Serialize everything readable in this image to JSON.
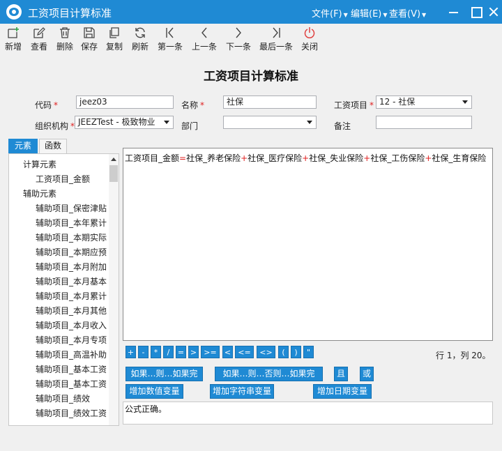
{
  "window": {
    "title": "工资项目计算标准",
    "menus": [
      {
        "label": "文件(F)"
      },
      {
        "label": "编辑(E)"
      },
      {
        "label": "查看(V)"
      }
    ],
    "accent": "#1f8ad4"
  },
  "toolbar": {
    "items": [
      {
        "label": "新增",
        "icon": "add-icon"
      },
      {
        "label": "查看",
        "icon": "edit-icon"
      },
      {
        "label": "删除",
        "icon": "trash-icon"
      },
      {
        "label": "保存",
        "icon": "save-icon"
      },
      {
        "label": "复制",
        "icon": "copy-icon"
      },
      {
        "label": "刷新",
        "icon": "refresh-icon"
      },
      {
        "label": "第一条",
        "icon": "first-icon"
      },
      {
        "label": "上一条",
        "icon": "prev-icon"
      },
      {
        "label": "下一条",
        "icon": "next-icon"
      },
      {
        "label": "最后一条",
        "icon": "last-icon"
      },
      {
        "label": "关闭",
        "icon": "power-icon"
      }
    ]
  },
  "form": {
    "heading": "工资项目计算标准",
    "code_label": "代码",
    "code_value": "jeez03",
    "name_label": "名称",
    "name_value": "社保",
    "item_label": "工资项目",
    "item_value": "12 - 社保",
    "org_label": "组织机构",
    "org_value": "JEEZTest  - 极致物业",
    "dept_label": "部门",
    "dept_value": "",
    "note_label": "备注",
    "note_value": "",
    "required_mark": "*"
  },
  "panel": {
    "tabs": [
      {
        "label": "元素"
      },
      {
        "label": "函数"
      }
    ],
    "tree": [
      {
        "label": "计算元素"
      },
      {
        "label": "工资项目_金额"
      },
      {
        "label": "辅助元素"
      },
      {
        "label": "辅助项目_保密津贴"
      },
      {
        "label": "辅助项目_本年累计"
      },
      {
        "label": "辅助项目_本期实际"
      },
      {
        "label": "辅助项目_本期应预"
      },
      {
        "label": "辅助项目_本月附加"
      },
      {
        "label": "辅助项目_本月基本"
      },
      {
        "label": "辅助项目_本月累计"
      },
      {
        "label": "辅助项目_本月其他"
      },
      {
        "label": "辅助项目_本月收入"
      },
      {
        "label": "辅助项目_本月专项"
      },
      {
        "label": "辅助项目_高温补助"
      },
      {
        "label": "辅助项目_基本工资"
      },
      {
        "label": "辅助项目_基本工资"
      },
      {
        "label": "辅助项目_绩效"
      },
      {
        "label": "辅助项目_绩效工资"
      }
    ]
  },
  "editor": {
    "parts": [
      {
        "text": "工资项目_金额"
      },
      {
        "text": "="
      },
      {
        "text": "社保_养老保险"
      },
      {
        "text": "+"
      },
      {
        "text": "社保_医疗保险"
      },
      {
        "text": "+"
      },
      {
        "text": "社保_失业保险"
      },
      {
        "text": "+"
      },
      {
        "text": "社保_工伤保险"
      },
      {
        "text": "+"
      },
      {
        "text": "社保_生育保险"
      }
    ],
    "operators": [
      "+",
      "-",
      "*",
      "/",
      "=",
      ">",
      ">=",
      "<",
      "<=",
      "<>",
      "(",
      ")",
      "\""
    ],
    "position": "行 1，列 20。"
  },
  "actions": {
    "if_then": "如果…则…如果完",
    "if_then_else": "如果…则…否则…如果完",
    "and": "且",
    "or": "或",
    "add_number_var": "增加数值变量",
    "add_string_var": "增加字符串变量",
    "add_date_var": "增加日期变量"
  },
  "result": {
    "message": "公式正确。"
  }
}
